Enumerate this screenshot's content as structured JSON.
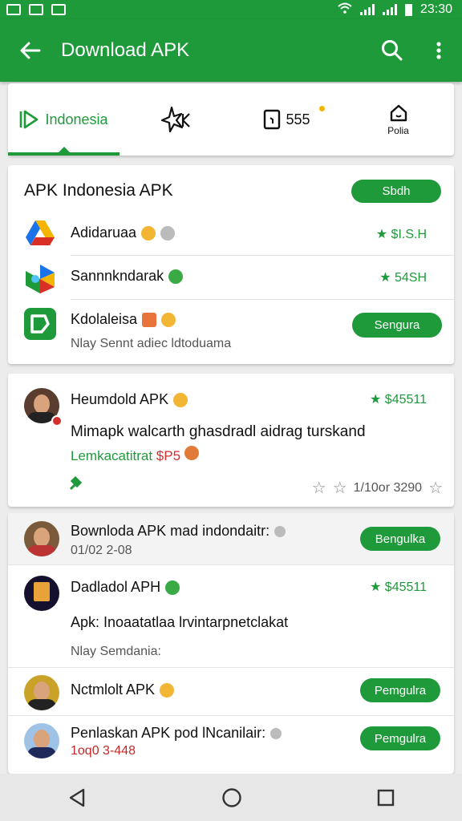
{
  "status_bar": {
    "time": "23:30"
  },
  "app_bar": {
    "title": "Download APK"
  },
  "tabs": [
    {
      "label": "Indonesia",
      "active": true
    },
    {
      "label": "",
      "icon": "apk-icon"
    },
    {
      "label": "555",
      "icon": "tablet-icon",
      "has_dot": true
    },
    {
      "label": "Polia",
      "icon": "home-icon"
    }
  ],
  "section1": {
    "title": "APK Indonesia APK",
    "button": "Sbdh",
    "items": [
      {
        "name": "Adidaruaa",
        "price": "★ $I.S.H"
      },
      {
        "name": "Sannnkndarak",
        "price": "★ 54SH"
      },
      {
        "name": "Kdolaleisa",
        "button": "Sengura",
        "subtitle": "Nlay Sennt adiec ldtoduama"
      }
    ]
  },
  "post": {
    "name": "Heumdold APK",
    "price": "★ $45511",
    "text": "Mimapk walcarth ghasdradl aidrag turskand",
    "tag_green": "Lemkacatitrat",
    "tag_red": "$P5",
    "rating": "1/10or 3290"
  },
  "list": [
    {
      "name": "Bownloda APK mad indondaitr:",
      "date": "01/02 2-08",
      "button": "Bengulka"
    },
    {
      "name": "Dadladol APH",
      "price": "★ $45511",
      "text": "Apk: Inoaatatlaa lrvintarpnetclakat",
      "subtitle": "Nlay Semdania:"
    },
    {
      "name": "Nctmlolt APK",
      "button": "Pemgulra"
    },
    {
      "name": "Penlaskan APK pod lNcanilair:",
      "date": "1oq0 3-448",
      "button": "Pemgulra"
    }
  ],
  "colors": {
    "accent": "#1e9a3a",
    "red": "#d32f2f"
  }
}
